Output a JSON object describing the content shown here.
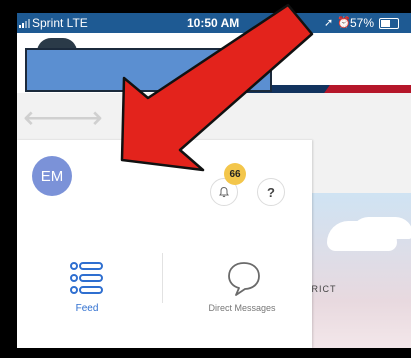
{
  "status_bar": {
    "carrier": "Sprint  LTE",
    "time": "10:50 AM",
    "battery": "57%"
  },
  "profile": {
    "initials": "EM"
  },
  "notifications": {
    "badge_count": "66"
  },
  "help": {
    "label": "?"
  },
  "background": {
    "district_text": "TRICT"
  },
  "nav": {
    "feed_label": "Feed",
    "dm_label": "Direct Messages"
  },
  "icons": {
    "signal": "signal-bars-icon",
    "location": "location-arrow-icon",
    "alarm": "alarm-icon",
    "battery": "battery-icon",
    "back": "back-arrow-icon",
    "forward": "forward-arrow-icon",
    "bell": "bell-icon",
    "feed": "list-icon",
    "dm": "chat-bubble-icon"
  },
  "colors": {
    "status_bar": "#1e5a93",
    "avatar": "#7b92d8",
    "badge": "#f3c64b",
    "accent": "#2f6fd0",
    "arrow": "#e3231c"
  }
}
